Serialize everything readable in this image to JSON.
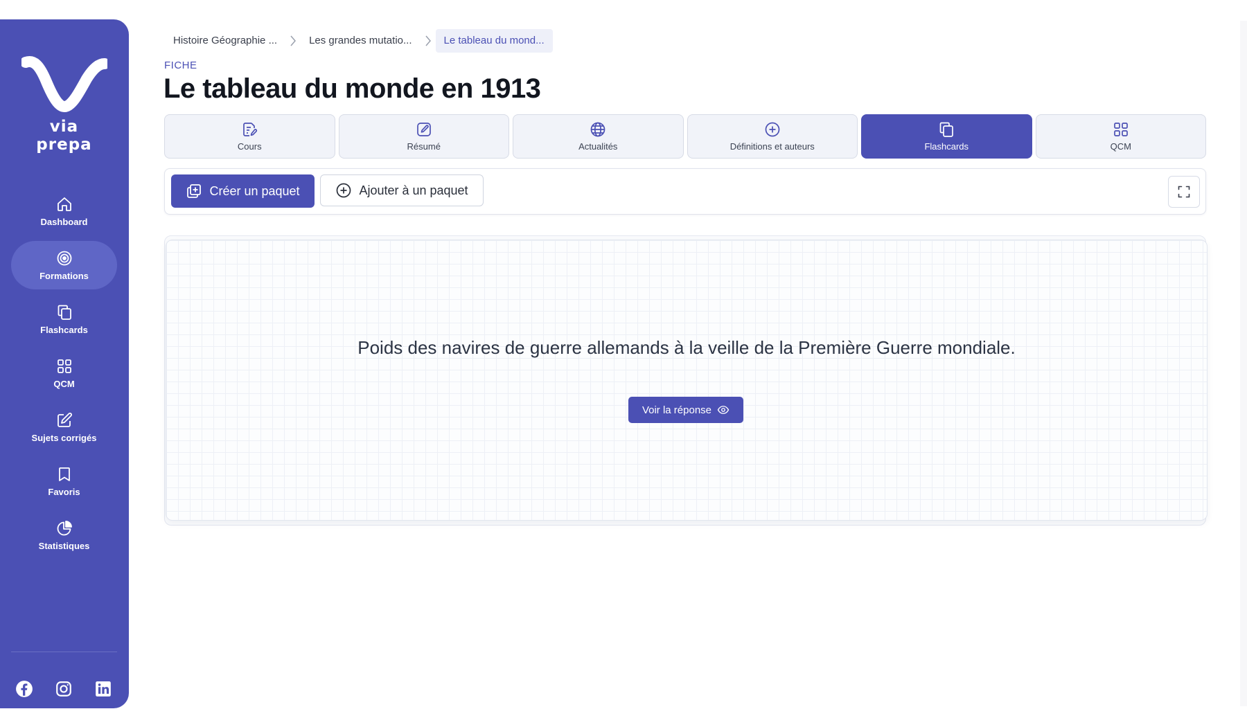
{
  "sidebar": {
    "logo_text": "via prepa",
    "items": [
      {
        "label": "Dashboard",
        "icon": "home-icon",
        "active": false
      },
      {
        "label": "Formations",
        "icon": "target-icon",
        "active": true
      },
      {
        "label": "Flashcards",
        "icon": "cards-icon",
        "active": false
      },
      {
        "label": "QCM",
        "icon": "grid-icon",
        "active": false
      },
      {
        "label": "Sujets corrigés",
        "icon": "edit-icon",
        "active": false
      },
      {
        "label": "Favoris",
        "icon": "bookmark-icon",
        "active": false
      },
      {
        "label": "Statistiques",
        "icon": "pie-chart-icon",
        "active": false
      }
    ],
    "socials": [
      "facebook-icon",
      "instagram-icon",
      "linkedin-icon"
    ]
  },
  "breadcrumb": [
    "Histoire Géographie ...",
    "Les grandes mutatio...",
    "Le tableau du mond..."
  ],
  "page": {
    "kicker": "FICHE",
    "title": "Le tableau du monde en 1913"
  },
  "tabs": [
    {
      "label": "Cours",
      "icon": "document-icon",
      "active": false
    },
    {
      "label": "Résumé",
      "icon": "pen-square-icon",
      "active": false
    },
    {
      "label": "Actualités",
      "icon": "globe-icon",
      "active": false
    },
    {
      "label": "Définitions et auteurs",
      "icon": "plus-circle-icon",
      "active": false
    },
    {
      "label": "Flashcards",
      "icon": "cards-icon",
      "active": true
    },
    {
      "label": "QCM",
      "icon": "grid-icon",
      "active": false
    }
  ],
  "toolbar": {
    "create_label": "Créer un paquet",
    "add_label": "Ajouter à un paquet"
  },
  "flashcard": {
    "question": "Poids des navires de guerre allemands à la veille de la Première Guerre mondiale.",
    "reveal_label": "Voir la réponse"
  },
  "colors": {
    "brand": "#4b50b4",
    "sidebar_active": "#5f66c6",
    "tab_bg": "#f1f3f9"
  }
}
